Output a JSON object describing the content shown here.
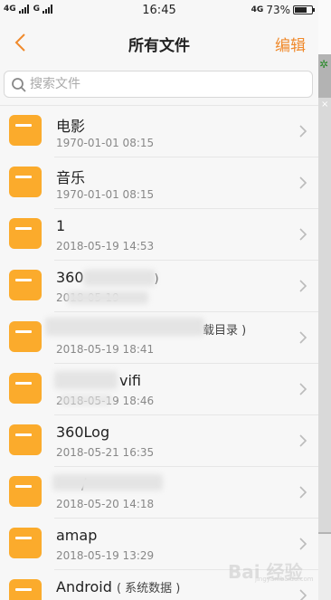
{
  "status_bar": {
    "carrier_1": "4G",
    "carrier_2": "G",
    "time": "16:45",
    "network": "4G",
    "battery_text": "73%",
    "battery_level": 0.73
  },
  "header": {
    "title": "所有文件",
    "edit_label": "编辑",
    "accent_color": "#f08a2c"
  },
  "search": {
    "placeholder": "搜索文件"
  },
  "files": [
    {
      "name": "电影",
      "note": "",
      "date": "1970-01-01 08:15"
    },
    {
      "name": "音乐",
      "note": "",
      "date": "1970-01-01 08:15"
    },
    {
      "name": "1",
      "note": "",
      "date": "2018-05-19 14:53"
    },
    {
      "name": "360",
      "note": ")",
      "date": "2018-05-19"
    },
    {
      "name": "",
      "note": "载目录 )",
      "date": "2018-05-19 18:41"
    },
    {
      "name": "vifi",
      "note": "",
      "date": "2018-05-19 18:46"
    },
    {
      "name": "360Log",
      "note": "",
      "date": "2018-05-21 16:35"
    },
    {
      "name": "/",
      "note": "",
      "date": "2018-05-20 14:18"
    },
    {
      "name": "amap",
      "note": "",
      "date": "2018-05-19 13:29"
    },
    {
      "name": "Android",
      "note": "( 系统数据 )",
      "date": ""
    }
  ],
  "folder_color": "#fbab2c",
  "watermark": {
    "text": "Bai 经验",
    "sub": "jingyan.baidu.com"
  },
  "icons": {
    "back": "chevron-left-icon",
    "search": "search-icon",
    "folder": "folder-icon",
    "row_arrow": "chevron-right-icon"
  }
}
